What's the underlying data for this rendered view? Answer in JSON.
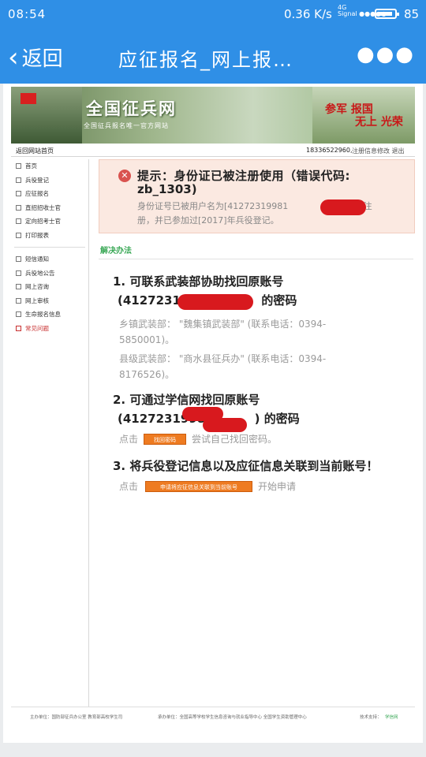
{
  "status_bar": {
    "time": "08:54",
    "net_speed": "0.36 K/s",
    "network": "4G",
    "signal_label": "Signal",
    "battery": "85"
  },
  "nav_bar": {
    "back_label": "返回",
    "title": "应征报名_网上报…",
    "more_icon": "more-dots-icon"
  },
  "site": {
    "logo": "全国征兵网",
    "slogan": "全国征兵报名唯一官方网站",
    "banner_join": "参军 报国",
    "banner_glory": "无上 光荣",
    "home_link": "返回网站首页",
    "phone": "18336522960,",
    "logout": "注册信息修改  退出"
  },
  "sidebar": {
    "group1": [
      "首页",
      "兵役登记",
      "应征报名",
      "直招招收士官",
      "定向招考士官",
      "打印报表"
    ],
    "group2": [
      "短信通知",
      "兵役地公告",
      "网上咨询",
      "网上审核",
      "生命报名信息",
      "常见问题"
    ],
    "active": "常见问题"
  },
  "alert": {
    "title_line1": "提示：身份证已被注册使用（错误代码:",
    "title_line2": "zb_1303)",
    "desc_line1": "身份证号已被用户名为[41272319981",
    "desc_line1_tail": "]的账号注",
    "desc_line2": "册，并已参加过[2017]年兵役登记。"
  },
  "solution_heading": "解决办法",
  "steps": {
    "s1_line1": "1. 可联系武装部协助找回原账号",
    "s1_line2_prefix": "(41272319",
    "s1_line2_suffix": "的密码",
    "s1_township": "乡镇武装部：  \"魏集镇武装部\"  (联系电话：0394-",
    "s1_township_2": "5850001)。",
    "s1_county": "县级武装部：  \"商水县征兵办\"  (联系电话：0394-",
    "s1_county_2": "8176526)。",
    "s2_line1": "2. 可通过学信网找回原账号",
    "s2_line2_prefix": "(41272319981",
    "s2_line2_suffix": ") 的密码",
    "s2_click": "点击",
    "s2_button": "找回密码",
    "s2_tail": "尝试自己找回密码。",
    "s3_line1": "3. 将兵役登记信息以及应征信息关联到当前账号！",
    "s3_click": "点击",
    "s3_button": "申请将应征信息关联到当前账号",
    "s3_tail": "开始申请"
  },
  "footer": {
    "host": "主办单位：国防部征兵办公室  教育部高校学生司",
    "undertake": "承办单位：全国高等学校学生信息咨询与就业指导中心  全国学生资助管理中心",
    "support_label": "技术支持：",
    "support_link": "学信网"
  },
  "colors": {
    "brand_blue": "#2f8fe6",
    "alert_bg": "#fbe9e1",
    "error_red": "#d9534f",
    "accent_green": "#3aa856",
    "button_orange": "#ee7b21"
  }
}
